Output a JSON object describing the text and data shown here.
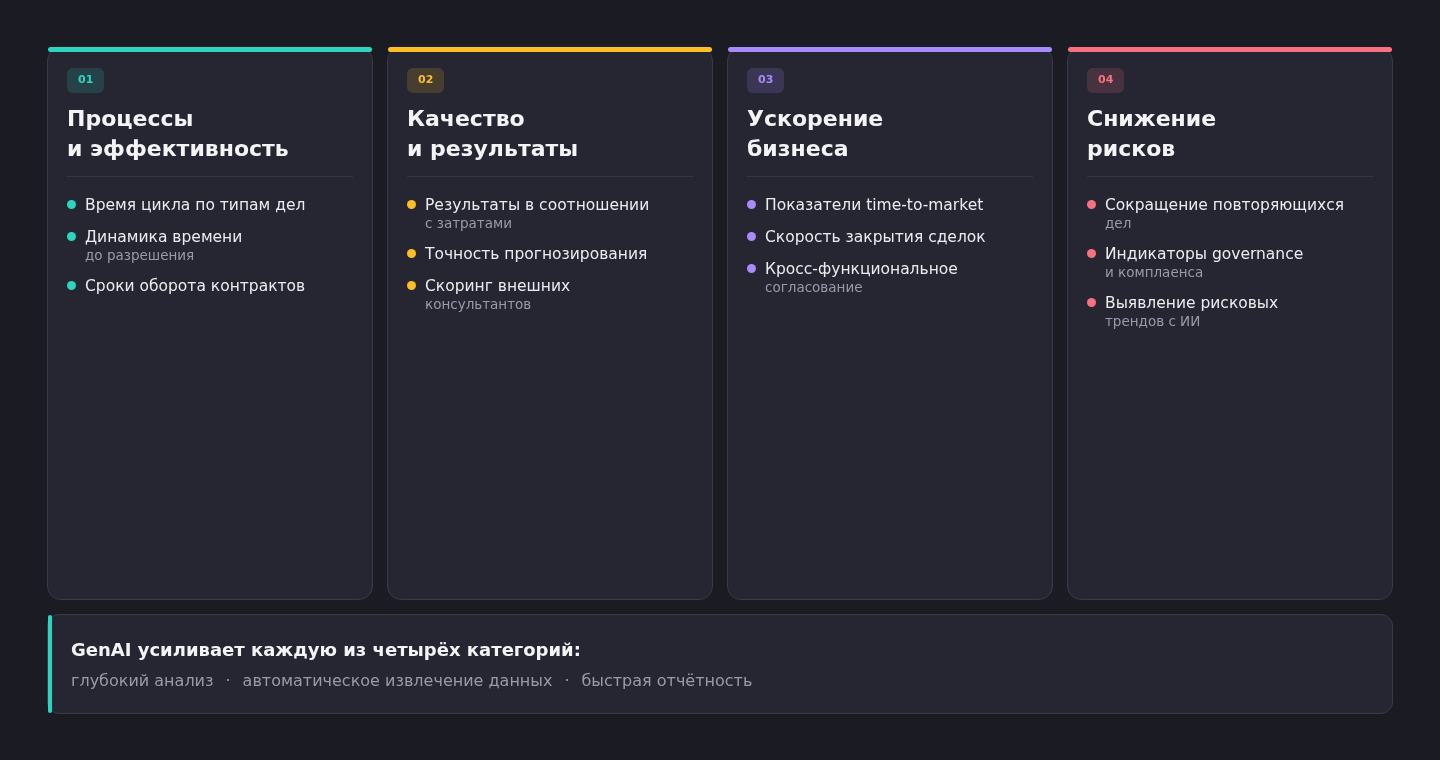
{
  "categories": [
    {
      "number": "01",
      "color": "#2dd4bf",
      "title": [
        "Процессы",
        "и эффективность"
      ],
      "items": [
        {
          "text": "Время цикла по типам дел"
        },
        {
          "text": "Динамика времени",
          "note": "до разрешения"
        },
        {
          "text": "Сроки оборота контрактов"
        }
      ]
    },
    {
      "number": "02",
      "color": "#fbbf24",
      "title": [
        "Качество",
        "и результаты"
      ],
      "items": [
        {
          "text": "Результаты в соотношении",
          "note": "с затратами"
        },
        {
          "text": "Точность прогнозирования"
        },
        {
          "text": "Скоринг внешних",
          "note": "консультантов"
        }
      ]
    },
    {
      "number": "03",
      "color": "#a78bfa",
      "title": [
        "Ускорение",
        "бизнеса"
      ],
      "items": [
        {
          "text": "Показатели time-to-market"
        },
        {
          "text": "Скорость закрытия сделок"
        },
        {
          "text": "Кросс-функциональное",
          "note": "согласование"
        }
      ]
    },
    {
      "number": "04",
      "color": "#f8717f",
      "title": [
        "Снижение",
        "рисков"
      ],
      "items": [
        {
          "text": "Сокращение повторяющихся",
          "note": "дел"
        },
        {
          "text": "Индикаторы governance",
          "note": "и комплаенса"
        },
        {
          "text": "Выявление рисковых",
          "note": "трендов с ИИ"
        }
      ]
    }
  ],
  "footer": {
    "headline": "GenAI усиливает каждую из четырёх категорий:",
    "points": [
      "глубокий анализ",
      "автоматическое извлечение данных",
      "быстрая отчётность"
    ],
    "separator": "·"
  }
}
